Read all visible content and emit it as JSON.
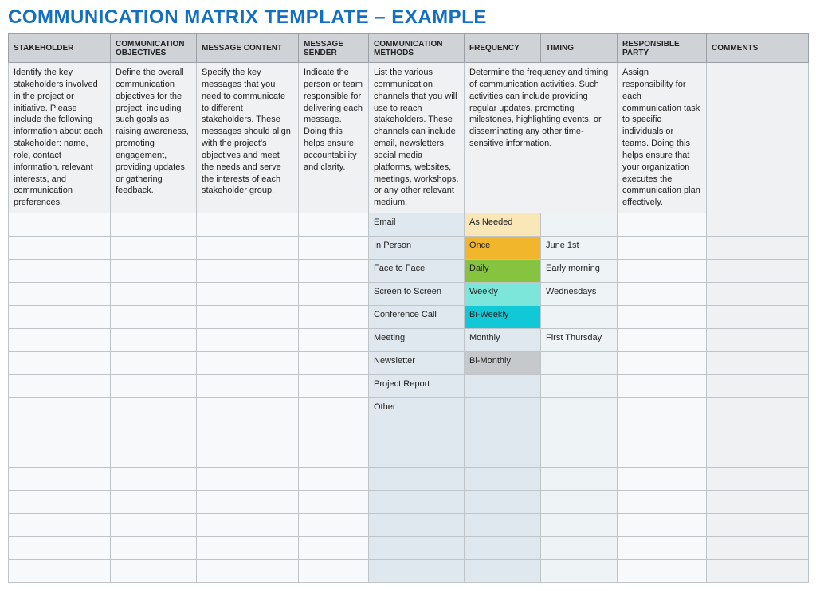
{
  "title": "COMMUNICATION MATRIX TEMPLATE  –  EXAMPLE",
  "headers": {
    "stakeholder": "STAKEHOLDER",
    "objectives": "COMMUNICATION OBJECTIVES",
    "message": "MESSAGE CONTENT",
    "sender": "MESSAGE SENDER",
    "methods": "COMMUNICATION METHODS",
    "frequency": "FREQUENCY",
    "timing": "TIMING",
    "party": "RESPONSIBLE PARTY",
    "comments": "COMMENTS"
  },
  "descriptions": {
    "stakeholder": "Identify the key stakeholders involved in the project or initiative. Please include the following information about each stakeholder: name, role, contact information, relevant interests, and communication preferences.",
    "objectives": "Define the overall communication objectives for the project, including such goals as raising awareness, promoting engagement, providing updates, or gathering feedback.",
    "message": "Specify the key messages that you need to communicate to different stakeholders. These messages should align with the project's objectives and meet the needs and serve the interests of each stakeholder group.",
    "sender": "Indicate the person or team responsible for delivering each message. Doing this helps ensure accountability and clarity.",
    "methods": "List the various communication channels that you will use to reach stakeholders. These channels can include email, newsletters, social media platforms, websites, meetings, workshops, or any other relevant medium.",
    "freq_timing": "Determine the frequency and timing of communication activities. Such activities can include providing regular updates, promoting milestones, highlighting events, or disseminating any other time-sensitive information.",
    "party": "Assign responsibility for each communication task to specific individuals or teams. Doing this helps ensure that your organization executes the communication plan effectively.",
    "comments": ""
  },
  "rows": [
    {
      "method": "Email",
      "frequency": "As Needed",
      "freq_class": "freq-asneeded",
      "timing": ""
    },
    {
      "method": "In Person",
      "frequency": "Once",
      "freq_class": "freq-once",
      "timing": "June 1st"
    },
    {
      "method": "Face to Face",
      "frequency": "Daily",
      "freq_class": "freq-daily",
      "timing": "Early morning"
    },
    {
      "method": "Screen to Screen",
      "frequency": "Weekly",
      "freq_class": "freq-weekly",
      "timing": "Wednesdays"
    },
    {
      "method": "Conference Call",
      "frequency": "Bi-Weekly",
      "freq_class": "freq-biweekly",
      "timing": ""
    },
    {
      "method": "Meeting",
      "frequency": "Monthly",
      "freq_class": "freq-monthly",
      "timing": "First Thursday"
    },
    {
      "method": "Newsletter",
      "frequency": "Bi-Monthly",
      "freq_class": "freq-bimonthly",
      "timing": ""
    },
    {
      "method": "Project Report",
      "frequency": "",
      "freq_class": "freq-empty",
      "timing": ""
    },
    {
      "method": "Other",
      "frequency": "",
      "freq_class": "freq-empty",
      "timing": ""
    },
    {
      "method": "",
      "frequency": "",
      "freq_class": "freq-empty",
      "timing": ""
    },
    {
      "method": "",
      "frequency": "",
      "freq_class": "freq-empty",
      "timing": ""
    },
    {
      "method": "",
      "frequency": "",
      "freq_class": "freq-empty",
      "timing": ""
    },
    {
      "method": "",
      "frequency": "",
      "freq_class": "freq-empty",
      "timing": ""
    },
    {
      "method": "",
      "frequency": "",
      "freq_class": "freq-empty",
      "timing": ""
    },
    {
      "method": "",
      "frequency": "",
      "freq_class": "freq-empty",
      "timing": ""
    },
    {
      "method": "",
      "frequency": "",
      "freq_class": "freq-empty",
      "timing": ""
    }
  ]
}
